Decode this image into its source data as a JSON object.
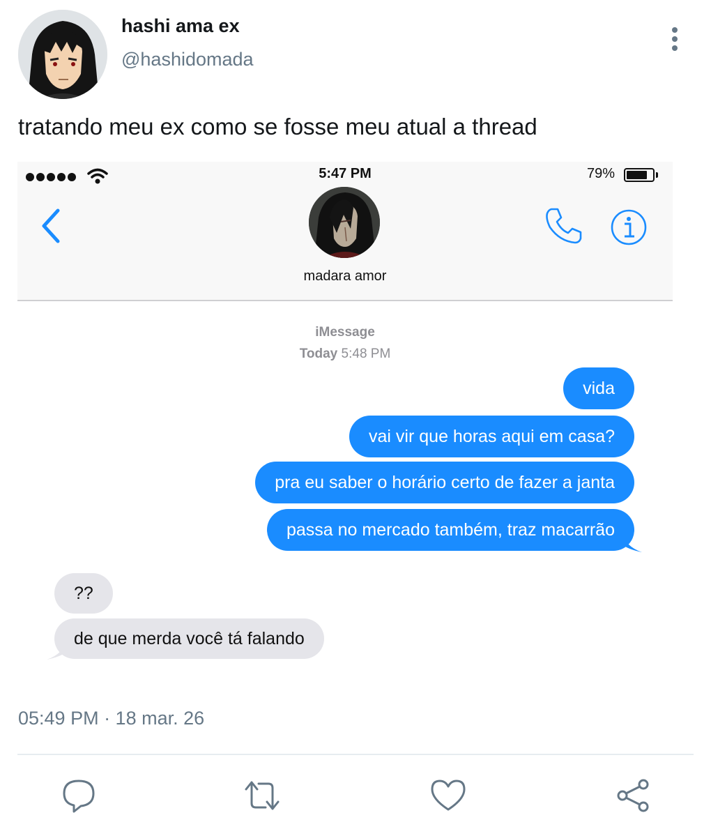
{
  "tweet": {
    "display_name": "hashi ama ex",
    "handle": "@hashidomada",
    "text": "tratando meu ex como se fosse meu atual a thread",
    "timestamp": "05:49 PM · 18 mar. 26"
  },
  "imessage": {
    "status_bar": {
      "time": "5:47 PM",
      "battery": "79%"
    },
    "contact_name": "madara amor",
    "service_label": "iMessage",
    "date_label": "Today",
    "time_label": "5:48 PM",
    "sent_messages": [
      "vida",
      "vai vir que horas aqui em casa?",
      "pra eu saber o horário certo de fazer a janta",
      "passa no mercado também, traz macarrão"
    ],
    "received_messages": [
      "??",
      "de que merda você tá falando"
    ]
  },
  "colors": {
    "ios_blue": "#1a8cff",
    "received_bubble": "#e5e5ea",
    "secondary_text": "#657786"
  },
  "icons": [
    "more-vertical-icon",
    "signal-dots-icon",
    "wifi-icon",
    "battery-icon",
    "back-chevron-icon",
    "phone-icon",
    "info-icon",
    "reply-icon",
    "retweet-icon",
    "like-icon",
    "share-icon"
  ]
}
